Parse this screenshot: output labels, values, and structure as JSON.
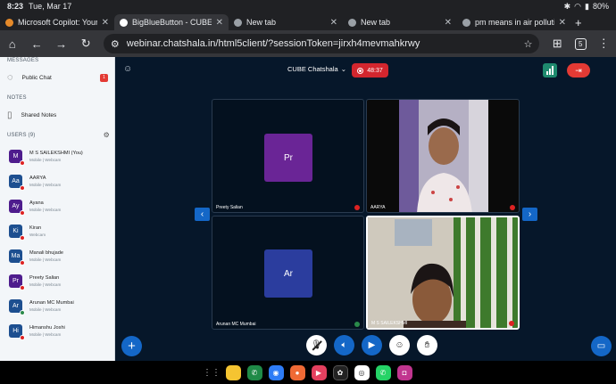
{
  "status": {
    "time": "8:23",
    "date": "Tue, Mar 17",
    "battery": "80%"
  },
  "tabs": [
    {
      "title": "Microsoft Copilot: Your AI",
      "color": "#e58a2a",
      "active": false
    },
    {
      "title": "BigBlueButton - CUBE Cha",
      "color": "#ffffff",
      "active": true
    },
    {
      "title": "New tab",
      "color": "#9aa0a6",
      "active": false
    },
    {
      "title": "New tab",
      "color": "#9aa0a6",
      "active": false
    },
    {
      "title": "pm means in air pollution",
      "color": "#9aa0a6",
      "active": false
    }
  ],
  "toolbar": {
    "url": "webinar.chatshala.in/html5client/?sessionToken=jirxh4mevmahkrwy",
    "tab_count": "5"
  },
  "sidebar": {
    "messages_title": "MESSAGES",
    "public_chat": "Public Chat",
    "public_chat_badge": "1",
    "notes_title": "NOTES",
    "shared_notes": "Shared Notes",
    "users_title": "USERS (9)",
    "users": [
      {
        "initials": "M",
        "name": "M S SAILEKSHMI (You)",
        "sub": "Mobile | Webcam",
        "color": "#4e1c8d",
        "mic": "red"
      },
      {
        "initials": "Aa",
        "name": "AARYA",
        "sub": "Mobile | Webcam",
        "color": "#1d4f90",
        "mic": "red"
      },
      {
        "initials": "Ay",
        "name": "Ayana",
        "sub": "Mobile | Webcam",
        "color": "#4e1c8d",
        "mic": "red"
      },
      {
        "initials": "Ki",
        "name": "Kiran",
        "sub": "Webcam",
        "color": "#1d4f90",
        "mic": "red"
      },
      {
        "initials": "Ma",
        "name": "Manali bhujade",
        "sub": "Mobile | Webcam",
        "color": "#1d4f90",
        "mic": "red"
      },
      {
        "initials": "Pr",
        "name": "Preety Salian",
        "sub": "Mobile | Webcam",
        "color": "#4e1c8d",
        "mic": "red"
      },
      {
        "initials": "Ar",
        "name": "Arunan MC Mumbai",
        "sub": "Mobile | Webcam",
        "color": "#1d4f90",
        "mic": "green"
      },
      {
        "initials": "Hi",
        "name": "Himanshu Joshi",
        "sub": "Mobile | Webcam",
        "color": "#1d4f90",
        "mic": "red"
      }
    ]
  },
  "meeting": {
    "title": "CUBE Chatshala",
    "timer": "48:37",
    "tiles": [
      {
        "label": "Preety Salian",
        "initials": "Pr",
        "color": "#6a2596",
        "mic": "red"
      },
      {
        "label": "AARYA",
        "mic": "red"
      },
      {
        "label": "Arunan MC Mumbai",
        "initials": "Ar",
        "color": "#2b3d9e",
        "mic": "green"
      },
      {
        "label": "M S SAILEKSHMI",
        "mic": "red"
      }
    ]
  }
}
